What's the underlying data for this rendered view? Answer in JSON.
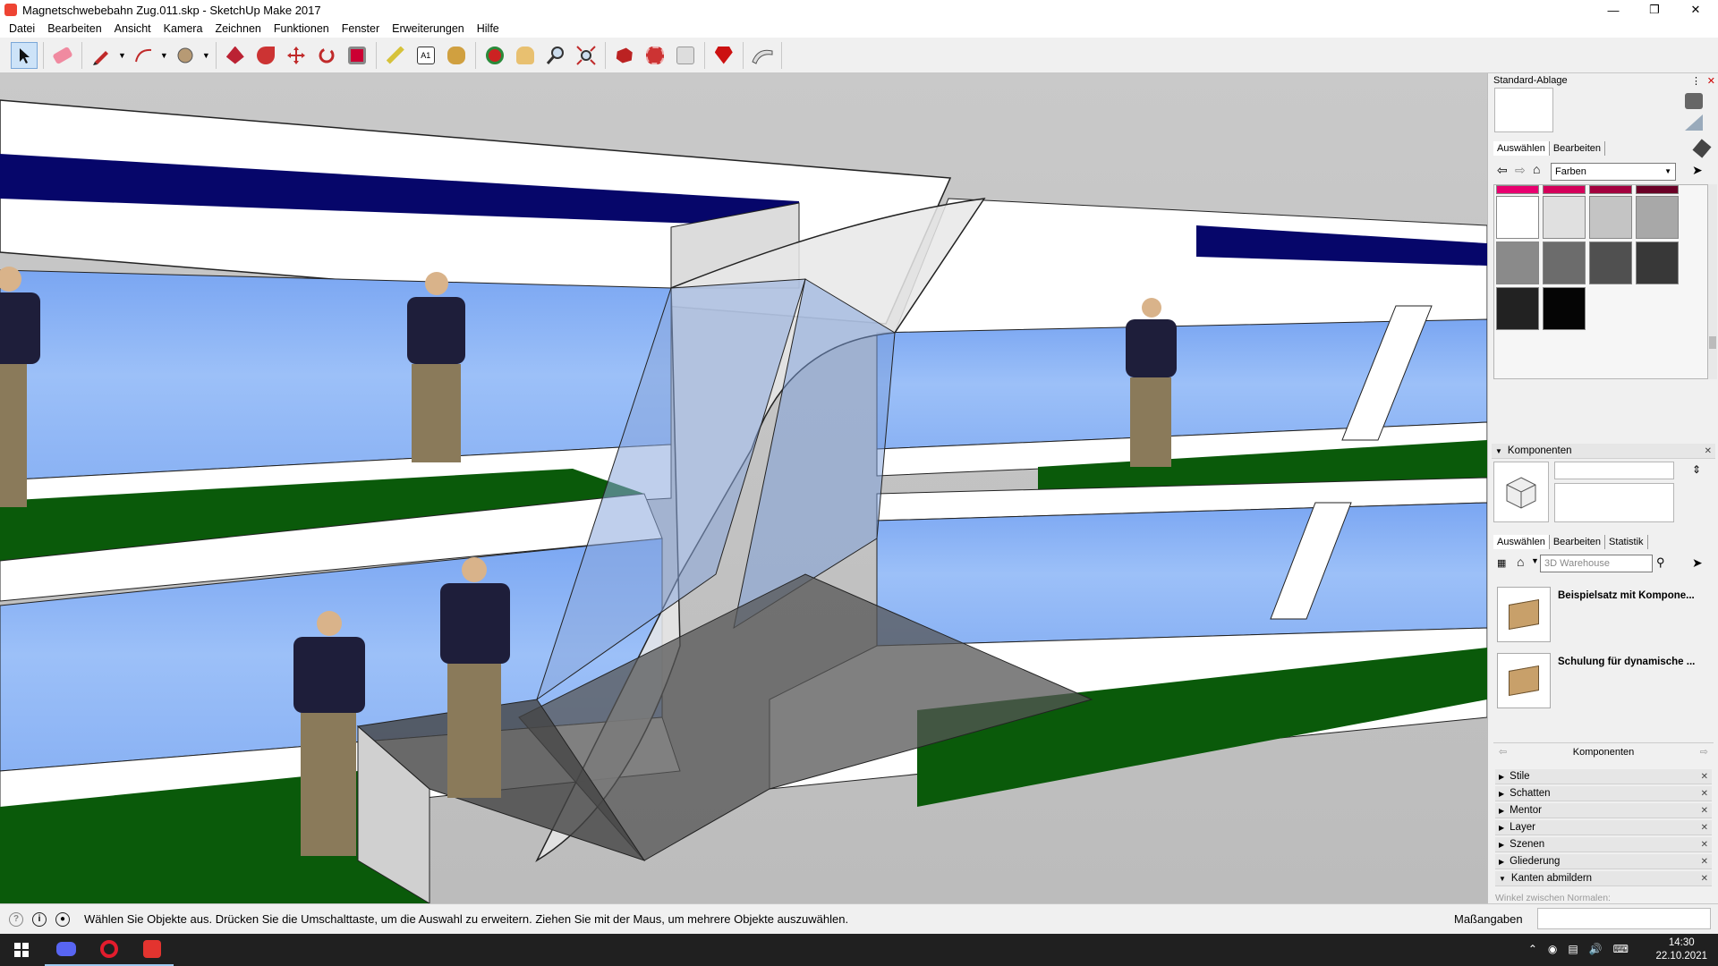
{
  "window": {
    "title": "Magnetschwebebahn Zug.011.skp - SketchUp Make 2017"
  },
  "menu": [
    "Datei",
    "Bearbeiten",
    "Ansicht",
    "Kamera",
    "Zeichnen",
    "Funktionen",
    "Fenster",
    "Erweiterungen",
    "Hilfe"
  ],
  "toolbar": [
    {
      "name": "select-tool",
      "icon": "arrow-cursor-icon",
      "active": true
    },
    {
      "name": "eraser-tool",
      "icon": "eraser-icon"
    },
    {
      "name": "line-tool",
      "icon": "pencil-icon"
    },
    {
      "name": "arc-tool",
      "icon": "arc-icon"
    },
    {
      "name": "circle-tool",
      "icon": "circle-icon"
    },
    {
      "name": "push-pull-tool",
      "icon": "push-pull-icon"
    },
    {
      "name": "follow-me-tool",
      "icon": "follow-me-icon"
    },
    {
      "name": "move-tool",
      "icon": "move-icon"
    },
    {
      "name": "rotate-tool",
      "icon": "rotate-icon"
    },
    {
      "name": "scale-tool",
      "icon": "scale-icon"
    },
    {
      "name": "tape-measure-tool",
      "icon": "tape-measure-icon"
    },
    {
      "name": "text-tool",
      "icon": "text-icon"
    },
    {
      "name": "paint-bucket-tool",
      "icon": "paint-bucket-icon"
    },
    {
      "name": "orbit-tool",
      "icon": "orbit-icon"
    },
    {
      "name": "pan-tool",
      "icon": "hand-icon"
    },
    {
      "name": "zoom-tool",
      "icon": "magnifier-icon"
    },
    {
      "name": "zoom-extents-tool",
      "icon": "zoom-extents-icon"
    },
    {
      "name": "warehouse-tool",
      "icon": "warehouse-icon"
    },
    {
      "name": "extension-warehouse-tool",
      "icon": "extension-warehouse-icon"
    },
    {
      "name": "layout-tool",
      "icon": "layout-icon"
    },
    {
      "name": "ruby-tool",
      "icon": "ruby-icon"
    },
    {
      "name": "sandbox-tool",
      "icon": "sandbox-icon"
    }
  ],
  "tray": {
    "title": "Standard-Ablage",
    "materials": {
      "tabs": [
        "Auswählen",
        "Bearbeiten"
      ],
      "library": "Farben",
      "swatch_colors": [
        "#e8006f",
        "#d4005a",
        "#a3003e",
        "#6a0026",
        "#ffffff",
        "#e0e0e0",
        "#c4c4c4",
        "#a8a8a8",
        "#8a8a8a",
        "#6c6c6c",
        "#505050",
        "#383838",
        "#222222",
        "#050505"
      ]
    },
    "components": {
      "header": "Komponenten",
      "tabs": [
        "Auswählen",
        "Bearbeiten",
        "Statistik"
      ],
      "search_placeholder": "3D Warehouse",
      "items": [
        "Beispielsatz mit Kompone...",
        "Schulung für dynamische ..."
      ],
      "footer": "Komponenten"
    },
    "sections": [
      "Stile",
      "Schatten",
      "Mentor",
      "Layer",
      "Szenen",
      "Gliederung",
      "Kanten abmildern"
    ],
    "soften_label": "Winkel zwischen Normalen:"
  },
  "status": {
    "message": "Wählen Sie Objekte aus. Drücken Sie die Umschalttaste, um die Auswahl zu erweitern. Ziehen Sie mit der Maus, um mehrere Objekte auszuwählen.",
    "measurements_label": "Maßangaben"
  },
  "taskbar": {
    "time": "14:30",
    "date": "22.10.2021"
  }
}
